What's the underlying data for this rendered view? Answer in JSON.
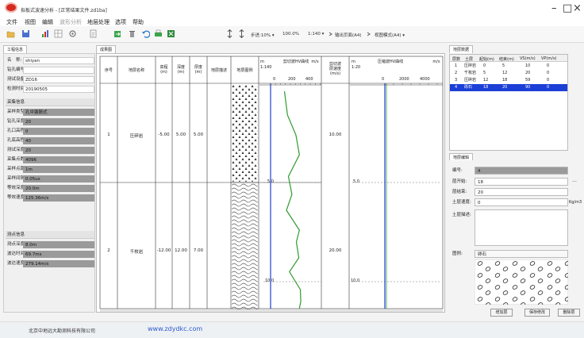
{
  "app": {
    "title": "拟板式波速分析 - [正常结果文件.zd1ba]",
    "window_buttons": {
      "minimize": "–",
      "maximize": "□",
      "close": "×"
    }
  },
  "menu": [
    "文件",
    "视图",
    "编辑",
    "波形分析",
    "地层处理",
    "选项",
    "帮助"
  ],
  "toolbar": {
    "step_label": "步进:10% ▾",
    "zoom_label": "100.0%",
    "scale_label": "1:140 ▾",
    "output_label": "输出页面(A4)",
    "view_mode_label": "视图模式(A4) ▾"
  },
  "left": {
    "tab": "工程信息",
    "project": [
      {
        "label": "名　称:",
        "value": "shiyan"
      },
      {
        "label": "钻孔编号:",
        "value": ""
      },
      {
        "label": "测试设备:",
        "value": "ZD16"
      },
      {
        "label": "检测时间:",
        "value": "20190505"
      }
    ],
    "collect_title": "采集信息",
    "collect": [
      {
        "label": "采样类型:",
        "value": "孔中激振式"
      },
      {
        "label": "钻孔深度:",
        "value": "20"
      },
      {
        "label": "孔口高程:",
        "value": "0"
      },
      {
        "label": "孔底高程:",
        "value": "40"
      },
      {
        "label": "测试深度:",
        "value": "20"
      },
      {
        "label": "采集点数:",
        "value": "4096"
      },
      {
        "label": "采样点距:",
        "value": "1m"
      },
      {
        "label": "采样间隔:",
        "value": "0.05us"
      },
      {
        "label": "等效深度:",
        "value": "20.0m"
      },
      {
        "label": "等效速度:",
        "value": "125.36m/s"
      }
    ],
    "point_title": "测点信息",
    "point": [
      {
        "label": "测点深度:",
        "value": "8.0m"
      },
      {
        "label": "波达时间:",
        "value": "69.7ms"
      },
      {
        "label": "波达速度:",
        "value": "279.14m/s"
      }
    ]
  },
  "sheet": {
    "tab": "成果图",
    "headers": {
      "seq": "序号",
      "name": "地层名称",
      "elev": "高程\n(m)",
      "depth": "深度\n(m)",
      "thick": "厚度\n(m)",
      "desc": "地层描述",
      "legend": "地层图例",
      "vs_m": "m",
      "vs_scale": "1:140",
      "vs_title": "剪切波HV曲线",
      "vs_unit": "m/s",
      "vel": "剪切波\n层速度\n(m/s)",
      "vp_m": "m",
      "vp_scale": "1:20",
      "vp_title": "压缩波HV曲线",
      "vp_unit": "m/s"
    },
    "vs_ticks": [
      "0",
      "200",
      "400"
    ],
    "vp_ticks": [
      "0",
      "2000",
      "4000"
    ],
    "depth_marks": [
      "5.0",
      "10.0"
    ],
    "layers": [
      {
        "seq": "1",
        "name": "压碎岩",
        "elev": "-5.00",
        "depth": "5.00",
        "thick": "5.00",
        "vel": "10.00"
      },
      {
        "seq": "2",
        "name": "千枚岩",
        "elev": "-12.00",
        "depth": "12.00",
        "thick": "7.00",
        "vel": "20.00"
      }
    ]
  },
  "chart_data": {
    "type": "line",
    "title": "剪切波HV曲线",
    "xlabel": "m/s",
    "ylabel": "m",
    "xlim": [
      0,
      500
    ],
    "ylim": [
      12.5,
      0
    ],
    "series": [
      {
        "x": [
          140,
          170,
          255,
          290,
          180,
          215,
          160,
          290,
          260,
          285,
          190,
          300,
          305,
          280,
          150
        ],
        "y": [
          0.4,
          1.6,
          2.6,
          3.6,
          4.7,
          5.6,
          6.4,
          7.4,
          8.0,
          8.8,
          9.5,
          10.4,
          11.0,
          11.6,
          12.4
        ]
      }
    ]
  },
  "right": {
    "tab": "地层数据",
    "columns": [
      "层数",
      "土层",
      "起始(m)",
      "结束(m)",
      "VS(m/s)",
      "VP(m/s)"
    ],
    "rows": [
      {
        "n": "1",
        "soil": "压碎岩",
        "start": "0",
        "end": "5",
        "vs": "10",
        "vp": "0"
      },
      {
        "n": "2",
        "soil": "千枚岩",
        "start": "5",
        "end": "12",
        "vs": "20",
        "vp": "0"
      },
      {
        "n": "3",
        "soil": "压碎岩",
        "start": "12",
        "end": "18",
        "vs": "59",
        "vp": "0"
      },
      {
        "n": "4",
        "soil": "砾石",
        "start": "18",
        "end": "20",
        "vs": "90",
        "vp": "0"
      }
    ],
    "editor_tab": "地层编辑",
    "edit": {
      "num_label": "编号:",
      "num": "4",
      "start_label": "层开始:",
      "start": "18",
      "end_label": "层结束:",
      "end": "20",
      "vel_label": "土层速度:",
      "vel": "0",
      "vel_unit": "Kg/m3",
      "desc_label": "土层描述:",
      "legend_label": "图例:",
      "legend": "卵石"
    },
    "buttons": {
      "add": "增加层",
      "save": "保存修改",
      "delete": "删除层"
    }
  },
  "status": {
    "company": "北京中地远大勘测科技有限公司",
    "url": "www.zdydkc.com"
  },
  "colors": {
    "accent": "#1c3fd6",
    "chart_line": "#2f9a2f",
    "selection": "#1c3fd6",
    "app_red": "#d42a1e"
  }
}
